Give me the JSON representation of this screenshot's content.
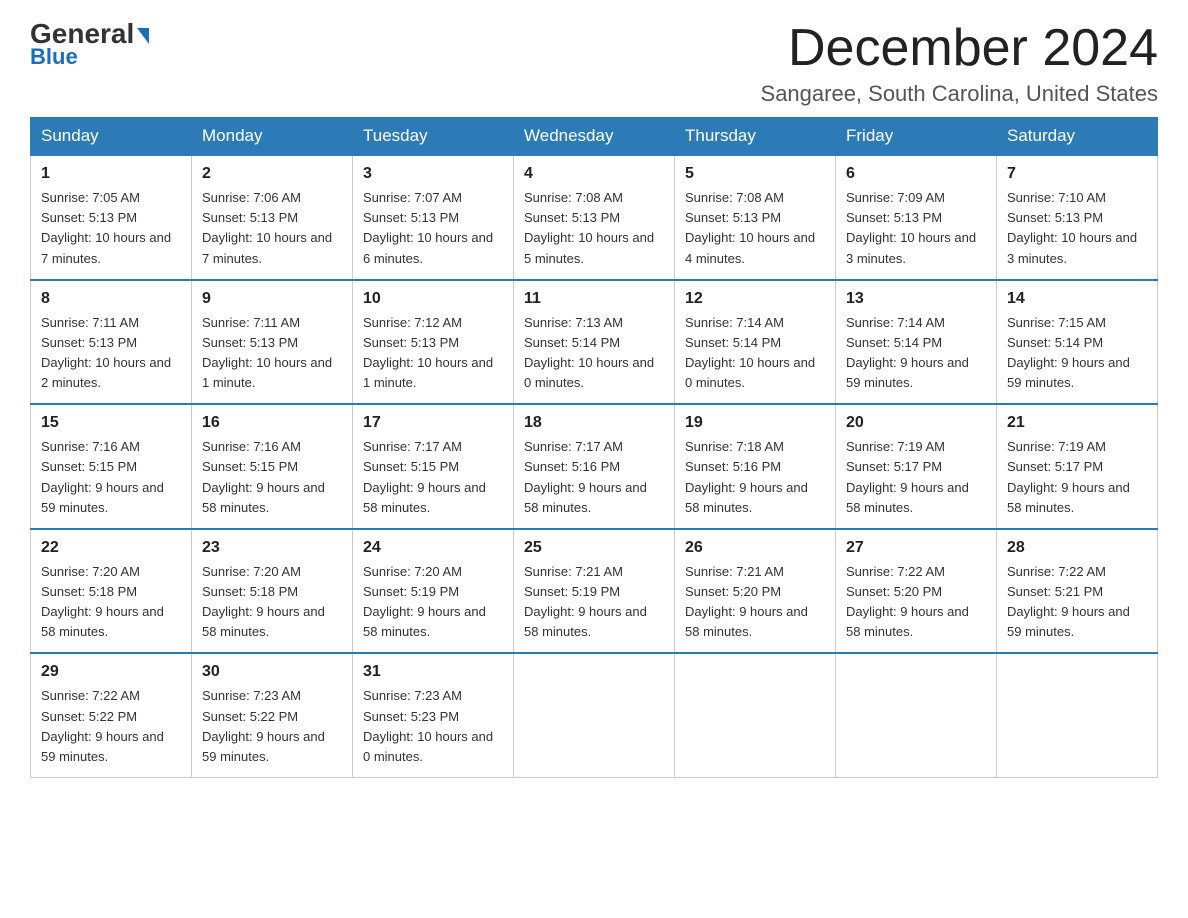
{
  "logo": {
    "general": "General",
    "blue": "Blue"
  },
  "header": {
    "month": "December 2024",
    "location": "Sangaree, South Carolina, United States"
  },
  "days_of_week": [
    "Sunday",
    "Monday",
    "Tuesday",
    "Wednesday",
    "Thursday",
    "Friday",
    "Saturday"
  ],
  "weeks": [
    [
      {
        "day": "1",
        "sunrise": "7:05 AM",
        "sunset": "5:13 PM",
        "daylight": "10 hours and 7 minutes."
      },
      {
        "day": "2",
        "sunrise": "7:06 AM",
        "sunset": "5:13 PM",
        "daylight": "10 hours and 7 minutes."
      },
      {
        "day": "3",
        "sunrise": "7:07 AM",
        "sunset": "5:13 PM",
        "daylight": "10 hours and 6 minutes."
      },
      {
        "day": "4",
        "sunrise": "7:08 AM",
        "sunset": "5:13 PM",
        "daylight": "10 hours and 5 minutes."
      },
      {
        "day": "5",
        "sunrise": "7:08 AM",
        "sunset": "5:13 PM",
        "daylight": "10 hours and 4 minutes."
      },
      {
        "day": "6",
        "sunrise": "7:09 AM",
        "sunset": "5:13 PM",
        "daylight": "10 hours and 3 minutes."
      },
      {
        "day": "7",
        "sunrise": "7:10 AM",
        "sunset": "5:13 PM",
        "daylight": "10 hours and 3 minutes."
      }
    ],
    [
      {
        "day": "8",
        "sunrise": "7:11 AM",
        "sunset": "5:13 PM",
        "daylight": "10 hours and 2 minutes."
      },
      {
        "day": "9",
        "sunrise": "7:11 AM",
        "sunset": "5:13 PM",
        "daylight": "10 hours and 1 minute."
      },
      {
        "day": "10",
        "sunrise": "7:12 AM",
        "sunset": "5:13 PM",
        "daylight": "10 hours and 1 minute."
      },
      {
        "day": "11",
        "sunrise": "7:13 AM",
        "sunset": "5:14 PM",
        "daylight": "10 hours and 0 minutes."
      },
      {
        "day": "12",
        "sunrise": "7:14 AM",
        "sunset": "5:14 PM",
        "daylight": "10 hours and 0 minutes."
      },
      {
        "day": "13",
        "sunrise": "7:14 AM",
        "sunset": "5:14 PM",
        "daylight": "9 hours and 59 minutes."
      },
      {
        "day": "14",
        "sunrise": "7:15 AM",
        "sunset": "5:14 PM",
        "daylight": "9 hours and 59 minutes."
      }
    ],
    [
      {
        "day": "15",
        "sunrise": "7:16 AM",
        "sunset": "5:15 PM",
        "daylight": "9 hours and 59 minutes."
      },
      {
        "day": "16",
        "sunrise": "7:16 AM",
        "sunset": "5:15 PM",
        "daylight": "9 hours and 58 minutes."
      },
      {
        "day": "17",
        "sunrise": "7:17 AM",
        "sunset": "5:15 PM",
        "daylight": "9 hours and 58 minutes."
      },
      {
        "day": "18",
        "sunrise": "7:17 AM",
        "sunset": "5:16 PM",
        "daylight": "9 hours and 58 minutes."
      },
      {
        "day": "19",
        "sunrise": "7:18 AM",
        "sunset": "5:16 PM",
        "daylight": "9 hours and 58 minutes."
      },
      {
        "day": "20",
        "sunrise": "7:19 AM",
        "sunset": "5:17 PM",
        "daylight": "9 hours and 58 minutes."
      },
      {
        "day": "21",
        "sunrise": "7:19 AM",
        "sunset": "5:17 PM",
        "daylight": "9 hours and 58 minutes."
      }
    ],
    [
      {
        "day": "22",
        "sunrise": "7:20 AM",
        "sunset": "5:18 PM",
        "daylight": "9 hours and 58 minutes."
      },
      {
        "day": "23",
        "sunrise": "7:20 AM",
        "sunset": "5:18 PM",
        "daylight": "9 hours and 58 minutes."
      },
      {
        "day": "24",
        "sunrise": "7:20 AM",
        "sunset": "5:19 PM",
        "daylight": "9 hours and 58 minutes."
      },
      {
        "day": "25",
        "sunrise": "7:21 AM",
        "sunset": "5:19 PM",
        "daylight": "9 hours and 58 minutes."
      },
      {
        "day": "26",
        "sunrise": "7:21 AM",
        "sunset": "5:20 PM",
        "daylight": "9 hours and 58 minutes."
      },
      {
        "day": "27",
        "sunrise": "7:22 AM",
        "sunset": "5:20 PM",
        "daylight": "9 hours and 58 minutes."
      },
      {
        "day": "28",
        "sunrise": "7:22 AM",
        "sunset": "5:21 PM",
        "daylight": "9 hours and 59 minutes."
      }
    ],
    [
      {
        "day": "29",
        "sunrise": "7:22 AM",
        "sunset": "5:22 PM",
        "daylight": "9 hours and 59 minutes."
      },
      {
        "day": "30",
        "sunrise": "7:23 AM",
        "sunset": "5:22 PM",
        "daylight": "9 hours and 59 minutes."
      },
      {
        "day": "31",
        "sunrise": "7:23 AM",
        "sunset": "5:23 PM",
        "daylight": "10 hours and 0 minutes."
      },
      null,
      null,
      null,
      null
    ]
  ],
  "labels": {
    "sunrise": "Sunrise:",
    "sunset": "Sunset:",
    "daylight": "Daylight:"
  }
}
